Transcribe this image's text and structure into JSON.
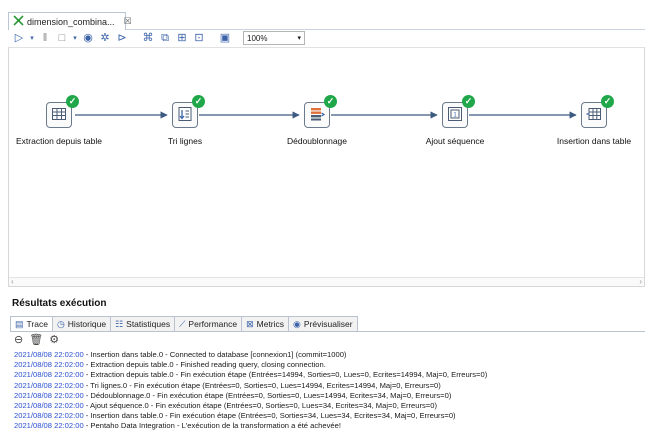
{
  "editor_tab": {
    "title": "dimension_combina...",
    "close": "☒"
  },
  "toolbar": {
    "zoom": "100%"
  },
  "steps": [
    {
      "id": "extraction",
      "label": "Extraction depuis table"
    },
    {
      "id": "tri",
      "label": "Tri lignes"
    },
    {
      "id": "dedoublonnage",
      "label": "Dédoublonnage"
    },
    {
      "id": "ajout",
      "label": "Ajout séquence"
    },
    {
      "id": "insertion",
      "label": "Insertion dans table"
    }
  ],
  "results": {
    "title": "Résultats exécution",
    "tabs": [
      {
        "label": "Trace",
        "icon": "trace-icon"
      },
      {
        "label": "Historique",
        "icon": "history-icon"
      },
      {
        "label": "Statistiques",
        "icon": "stats-icon"
      },
      {
        "label": "Performance",
        "icon": "performance-icon"
      },
      {
        "label": "Metrics",
        "icon": "metrics-icon"
      },
      {
        "label": "Prévisualiser",
        "icon": "eye-icon"
      }
    ],
    "log": [
      {
        "ts": "2021/08/08 22:02:00",
        "msg": " - Insertion dans table.0 - Connected to database [connexion1] (commit=1000)"
      },
      {
        "ts": "2021/08/08 22:02:00",
        "msg": " - Extraction depuis table.0 - Finished reading query, closing connection."
      },
      {
        "ts": "2021/08/08 22:02:00",
        "msg": " - Extraction depuis table.0 - Fin exécution étape (Entrées=14994, Sorties=0, Lues=0, Ecrites=14994, Maj=0, Erreurs=0)"
      },
      {
        "ts": "2021/08/08 22:02:00",
        "msg": " - Tri lignes.0 - Fin exécution étape (Entrées=0, Sorties=0, Lues=14994, Ecrites=14994, Maj=0, Erreurs=0)"
      },
      {
        "ts": "2021/08/08 22:02:00",
        "msg": " - Dédoublonnage.0 - Fin exécution étape (Entrées=0, Sorties=0, Lues=14994, Ecrites=34, Maj=0, Erreurs=0)"
      },
      {
        "ts": "2021/08/08 22:02:00",
        "msg": " - Ajout séquence.0 - Fin exécution étape (Entrées=0, Sorties=0, Lues=34, Ecrites=34, Maj=0, Erreurs=0)"
      },
      {
        "ts": "2021/08/08 22:02:00",
        "msg": " - Insertion dans table.0 - Fin exécution étape (Entrées=0, Sorties=34, Lues=34, Ecrites=34, Maj=0, Erreurs=0)"
      },
      {
        "ts": "2021/08/08 22:02:00",
        "msg": " - Pentaho Data Integration - L'exécution de la transformation a été achevée!"
      }
    ]
  }
}
